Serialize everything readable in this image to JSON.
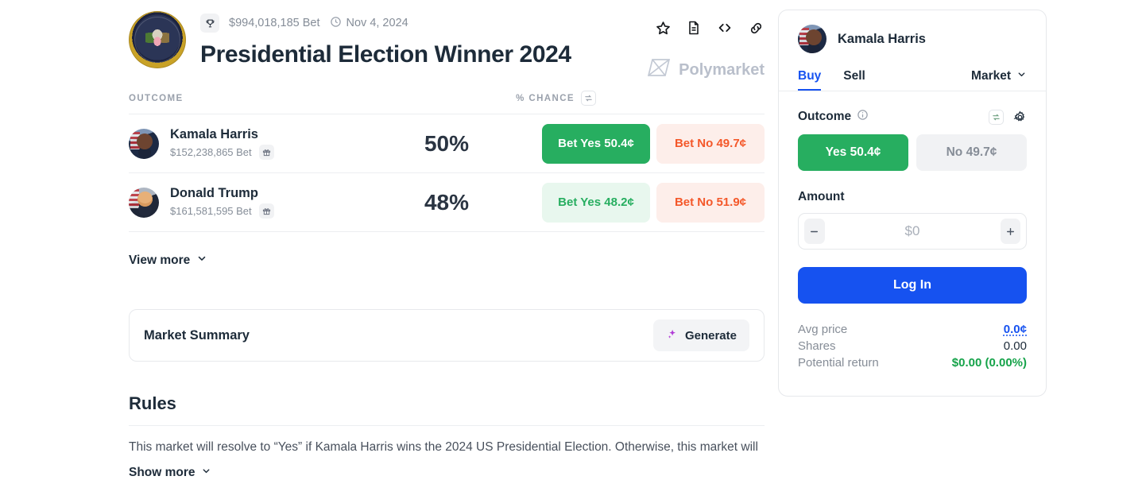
{
  "market": {
    "icon": "presidential-seal",
    "badge_icon": "trophy-icon",
    "volume": "$994,018,185 Bet",
    "clock_icon": "clock-icon",
    "date": "Nov 4, 2024",
    "title": "Presidential Election Winner 2024",
    "brand": "Polymarket",
    "brand_icon": "polymarket-logo-icon",
    "header_icons": [
      {
        "name": "star-icon",
        "label": "Watchlist"
      },
      {
        "name": "document-icon",
        "label": "Rules"
      },
      {
        "name": "code-icon",
        "label": "Embed"
      },
      {
        "name": "link-icon",
        "label": "Copy link"
      }
    ]
  },
  "table": {
    "col_outcome": "OUTCOME",
    "col_chance": "% CHANCE",
    "swap_icon": "swap-refresh-icon",
    "rows": [
      {
        "name": "Kamala Harris",
        "avatar": "kamala-harris-avatar",
        "bet": "$152,238,865 Bet",
        "gift_icon": "gift-icon",
        "chance": "50%",
        "yes_label": "Bet Yes 50.4¢",
        "no_label": "Bet No 49.7¢",
        "yes_style": "solid"
      },
      {
        "name": "Donald Trump",
        "avatar": "donald-trump-avatar",
        "bet": "$161,581,595 Bet",
        "gift_icon": "gift-icon",
        "chance": "48%",
        "yes_label": "Bet Yes 48.2¢",
        "no_label": "Bet No 51.9¢",
        "yes_style": "light"
      }
    ],
    "view_more": "View more",
    "chevron_icon": "chevron-down-icon"
  },
  "summary": {
    "title": "Market Summary",
    "generate_label": "Generate",
    "sparkle_icon": "sparkle-icon"
  },
  "rules": {
    "title": "Rules",
    "text": "This market will resolve to “Yes” if Kamala Harris wins the 2024 US Presidential Election. Otherwise, this market will",
    "show_more": "Show more",
    "chevron_icon": "chevron-down-icon"
  },
  "panel": {
    "name": "Kamala Harris",
    "avatar": "kamala-harris-avatar",
    "tab_buy": "Buy",
    "tab_sell": "Sell",
    "active_tab": "Buy",
    "order_type": "Market",
    "order_chevron_icon": "chevron-down-icon",
    "outcome_label": "Outcome",
    "info_icon": "info-icon",
    "refresh_icon": "refresh-icon",
    "gear_icon": "gear-icon",
    "yes_label": "Yes 50.4¢",
    "no_label": "No 49.7¢",
    "amount_label": "Amount",
    "amount_value": "",
    "amount_placeholder": "$0",
    "minus_icon": "minus-icon",
    "plus_icon": "plus-icon",
    "login_label": "Log In",
    "stats": [
      {
        "key": "Avg price",
        "value": "0.0¢",
        "style": "link"
      },
      {
        "key": "Shares",
        "value": "0.00",
        "style": "plain"
      },
      {
        "key": "Potential return",
        "value": "$0.00 (0.00%)",
        "style": "green"
      }
    ]
  },
  "colors": {
    "accent_blue": "#1652f0",
    "yes_green": "#27ae60",
    "no_red": "#f4582a",
    "return_green": "#16a34a",
    "muted": "#868d97"
  }
}
